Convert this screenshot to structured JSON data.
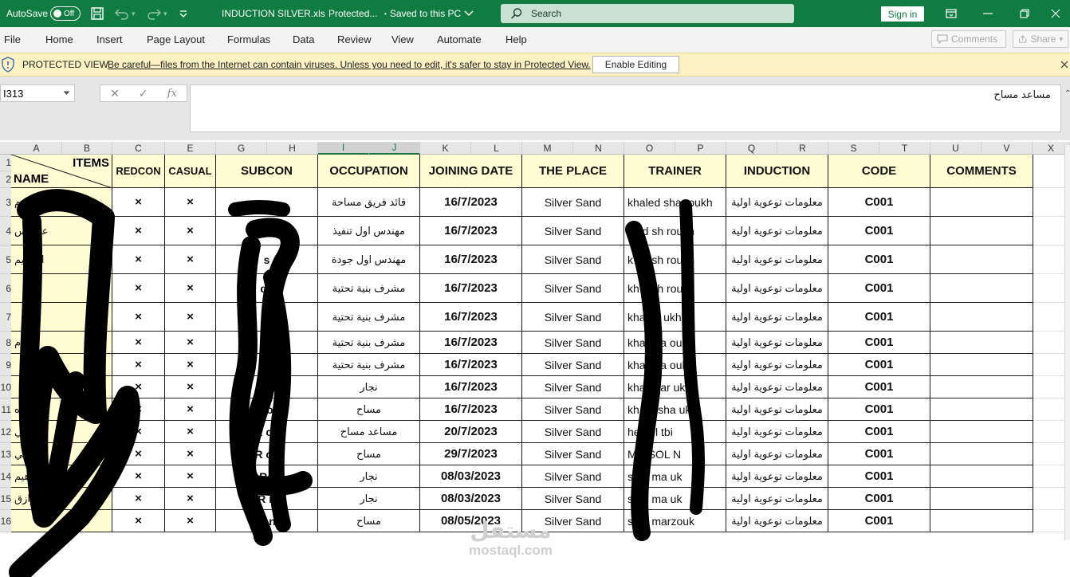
{
  "titlebar": {
    "autosave_label": "AutoSave",
    "autosave_state": "Off",
    "filename": "INDUCTION SILVER.xls",
    "mode": "Protected...",
    "save_status": "Saved to this PC",
    "search_placeholder": "Search",
    "signin_label": "Sign in"
  },
  "menu": {
    "items": [
      "File",
      "Home",
      "Insert",
      "Page Layout",
      "Formulas",
      "Data",
      "Review",
      "View",
      "Automate",
      "Help"
    ],
    "comments_label": "Comments",
    "share_label": "Share"
  },
  "protected_view": {
    "title": "PROTECTED VIEW",
    "message": "Be careful—files from the Internet can contain viruses. Unless you need to edit, it's safer to stay in Protected View.",
    "enable_label": "Enable Editing"
  },
  "formula_bar": {
    "name_box": "I313",
    "content": "مساعد مساح"
  },
  "grid": {
    "column_letters": [
      "A",
      "B",
      "C",
      "E",
      "G",
      "H",
      "I",
      "J",
      "K",
      "L",
      "M",
      "N",
      "O",
      "P",
      "Q",
      "R",
      "S",
      "T",
      "U",
      "V",
      "X"
    ],
    "selected_columns": [
      "I",
      "J"
    ],
    "row_numbers": [
      "1",
      "2",
      "3",
      "4",
      "5",
      "6",
      "7",
      "8",
      "9",
      "10",
      "11",
      "12",
      "13",
      "14",
      "15",
      "16"
    ],
    "header": {
      "items": "ITEMS",
      "name": "NAME",
      "redcon": "REDCON",
      "casual": "CASUAL",
      "subcon": "SUBCON",
      "occupation": "OCCUPATION",
      "joining_date": "JOINING DATE",
      "the_place": "THE PLACE",
      "trainer": "TRAINER",
      "induction": "INDUCTION",
      "code": "CODE",
      "comments": "COMMENTS"
    },
    "rows": [
      {
        "name": "...د م",
        "redcon": "×",
        "casual": "×",
        "subcon": "",
        "occupation": "قائد فريق مساحة",
        "joining_date": "16/7/2023",
        "place": "Silver Sand",
        "trainer": "khaled sha roukh",
        "induction": "معلومات توعوية اولية",
        "code": "C001"
      },
      {
        "name": "عبدالس",
        "redcon": "×",
        "casual": "×",
        "subcon": "R",
        "occupation": "مهندس اول تنفيذ",
        "joining_date": "16/7/2023",
        "place": "Silver Sand",
        "trainer": "aled sh roukh",
        "induction": "معلومات توعوية اولية",
        "code": "C001"
      },
      {
        "name": "ابراهيم",
        "redcon": "×",
        "casual": "×",
        "subcon": "s",
        "occupation": "مهندس اول جودة",
        "joining_date": "16/7/2023",
        "place": "Silver Sand",
        "trainer": "k ed sh roukh",
        "induction": "معلومات توعوية اولية",
        "code": "C001"
      },
      {
        "name": "",
        "redcon": "×",
        "casual": "×",
        "subcon": "dc",
        "occupation": "مشرف بنية تحتية",
        "joining_date": "16/7/2023",
        "place": "Silver Sand",
        "trainer": "kh d sh roukh",
        "induction": "معلومات توعوية اولية",
        "code": "C001"
      },
      {
        "name": "",
        "redcon": "×",
        "casual": "×",
        "subcon": "",
        "occupation": "مشرف بنية تحتية",
        "joining_date": "16/7/2023",
        "place": "Silver Sand",
        "trainer": "kha sh ukh",
        "induction": "معلومات توعوية اولية",
        "code": "C001"
      },
      {
        "name": "م",
        "redcon": "×",
        "casual": "×",
        "subcon": "",
        "occupation": "مشرف بنية تحتية",
        "joining_date": "16/7/2023",
        "place": "Silver Sand",
        "trainer": "kha sha oukh",
        "induction": "معلومات توعوية اولية",
        "code": "C001"
      },
      {
        "name": "",
        "redcon": "×",
        "casual": "×",
        "subcon": "ed",
        "occupation": "مشرف بنية تحتية",
        "joining_date": "16/7/2023",
        "place": "Silver Sand",
        "trainer": "kha sha oukh",
        "induction": "معلومات توعوية اولية",
        "code": "C001"
      },
      {
        "name": "",
        "redcon": "×",
        "casual": "×",
        "subcon": "R n",
        "occupation": "نجار",
        "joining_date": "16/7/2023",
        "place": "Silver Sand",
        "trainer": "kha shar ukh",
        "induction": "معلومات توعوية اولية",
        "code": "C001"
      },
      {
        "name": "ه",
        "redcon": "×",
        "casual": "×",
        "subcon": "dcon",
        "occupation": "مساح",
        "joining_date": "16/7/2023",
        "place": "Silver Sand",
        "trainer": "kh ed sha ukh",
        "induction": "معلومات توعوية اولية",
        "code": "C001"
      },
      {
        "name": "سي",
        "redcon": "×",
        "casual": "×",
        "subcon": "R co",
        "occupation": "مساعد مساح",
        "joining_date": "20/7/2023",
        "place": "Silver Sand",
        "trainer": "hed el tbi",
        "induction": "معلومات توعوية اولية",
        "code": "C001"
      },
      {
        "name": "مص لي",
        "redcon": "×",
        "casual": "×",
        "subcon": "R co",
        "occupation": "مساح",
        "joining_date": "29/7/2023",
        "place": "Silver Sand",
        "trainer": "MR SOL N",
        "induction": "معلومات توعوية اولية",
        "code": "C001"
      },
      {
        "name": "مح هيم",
        "redcon": "×",
        "casual": "×",
        "subcon": "Ro",
        "occupation": "نجار",
        "joining_date": "08/03/2023",
        "place": "Silver Sand",
        "trainer": "sser ma uk",
        "induction": "معلومات توعوية اولية",
        "code": "C001"
      },
      {
        "name": "فتح الرازق",
        "redcon": "×",
        "casual": "×",
        "subcon": "R n",
        "occupation": "نجار",
        "joining_date": "08/03/2023",
        "place": "Silver Sand",
        "trainer": "sser ma uk",
        "induction": "معلومات توعوية اولية",
        "code": "C001"
      },
      {
        "name": "",
        "redcon": "×",
        "casual": "×",
        "subcon": "R n",
        "occupation": "مساح",
        "joining_date": "08/05/2023",
        "place": "Silver Sand",
        "trainer": "sser marzouk",
        "induction": "معلومات توعوية اولية",
        "code": "C001"
      }
    ]
  },
  "watermark": {
    "arabic": "مستقل",
    "latin": "mostaql.com"
  }
}
